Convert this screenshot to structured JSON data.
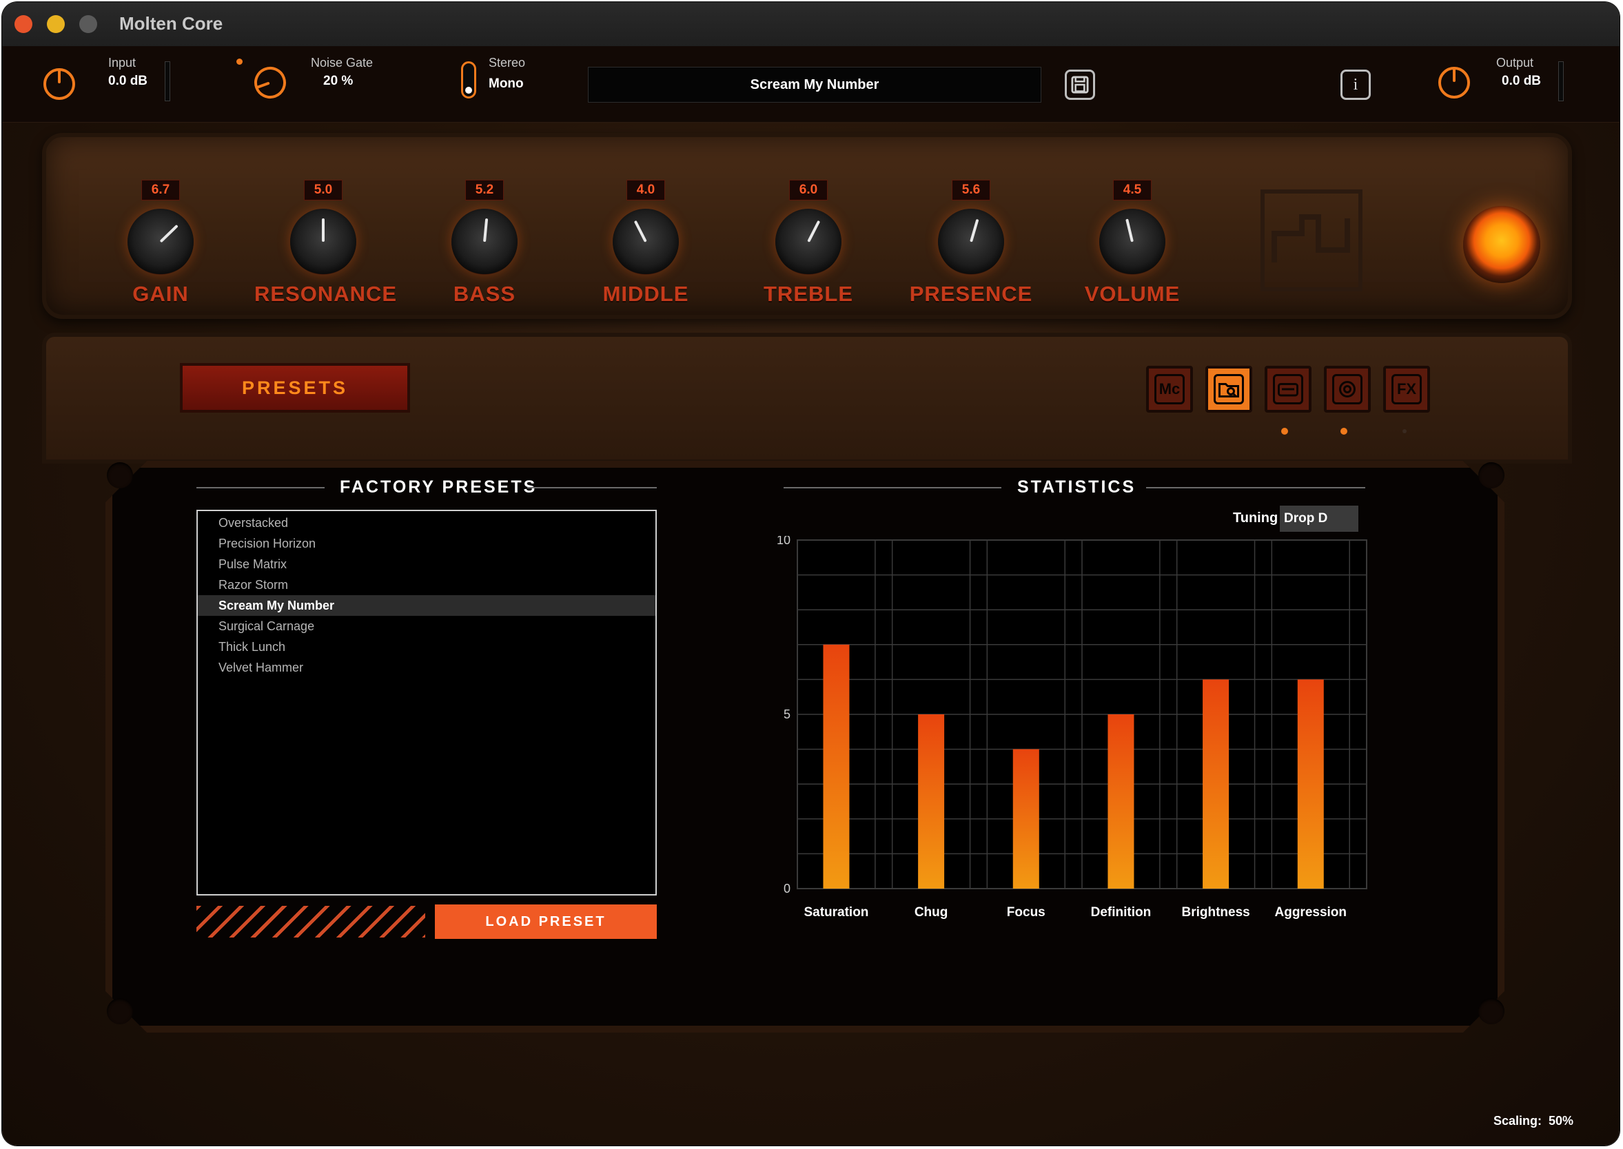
{
  "window": {
    "title": "Molten Core"
  },
  "topbar": {
    "input": {
      "label": "Input",
      "value": "0.0 dB"
    },
    "noise_gate": {
      "label": "Noise Gate",
      "value": "20 %"
    },
    "stereo": {
      "label": "Stereo",
      "value": "Mono"
    },
    "preset_name": "Scream My Number",
    "output": {
      "label": "Output",
      "value": "0.0 dB"
    },
    "info_glyph": "i"
  },
  "knobs": [
    {
      "name": "GAIN",
      "value": "6.7",
      "level": 6.7
    },
    {
      "name": "RESONANCE",
      "value": "5.0",
      "level": 5.0
    },
    {
      "name": "BASS",
      "value": "5.2",
      "level": 5.2
    },
    {
      "name": "MIDDLE",
      "value": "4.0",
      "level": 4.0
    },
    {
      "name": "TREBLE",
      "value": "6.0",
      "level": 6.0
    },
    {
      "name": "PRESENCE",
      "value": "5.6",
      "level": 5.6
    },
    {
      "name": "VOLUME",
      "value": "4.5",
      "level": 4.5
    }
  ],
  "presets_button": "PRESETS",
  "tabs": [
    {
      "label": "Mc",
      "icon": "mc-logo-icon"
    },
    {
      "label": "",
      "icon": "folder-search-icon"
    },
    {
      "label": "",
      "icon": "amp-head-icon"
    },
    {
      "label": "",
      "icon": "speaker-icon"
    },
    {
      "label": "FX",
      "icon": "fx-icon"
    }
  ],
  "factory_presets": {
    "title": "FACTORY PRESETS",
    "items": [
      "Overstacked",
      "Precision Horizon",
      "Pulse Matrix",
      "Razor Storm",
      "Scream My Number",
      "Surgical Carnage",
      "Thick Lunch",
      "Velvet Hammer"
    ],
    "selected": "Scream My Number",
    "load_button": "LOAD PRESET"
  },
  "statistics": {
    "title": "STATISTICS",
    "tuning_label": "Tuning",
    "tuning_value": "Drop D"
  },
  "chart_data": {
    "type": "bar",
    "categories": [
      "Saturation",
      "Chug",
      "Focus",
      "Definition",
      "Brightness",
      "Aggression"
    ],
    "values": [
      7,
      5,
      4,
      5,
      6,
      6
    ],
    "ylim": [
      0,
      10
    ],
    "yticks": [
      "0",
      "5",
      "10"
    ],
    "grid": true,
    "colors": {
      "bar_top": "#e8440e",
      "bar_bottom": "#f39a12",
      "grid": "#3a3a3a"
    }
  },
  "footer": {
    "scaling_label": "Scaling:",
    "scaling_value": "50%"
  },
  "colors": {
    "accent": "#f07a1c",
    "danger": "#f05a24"
  }
}
